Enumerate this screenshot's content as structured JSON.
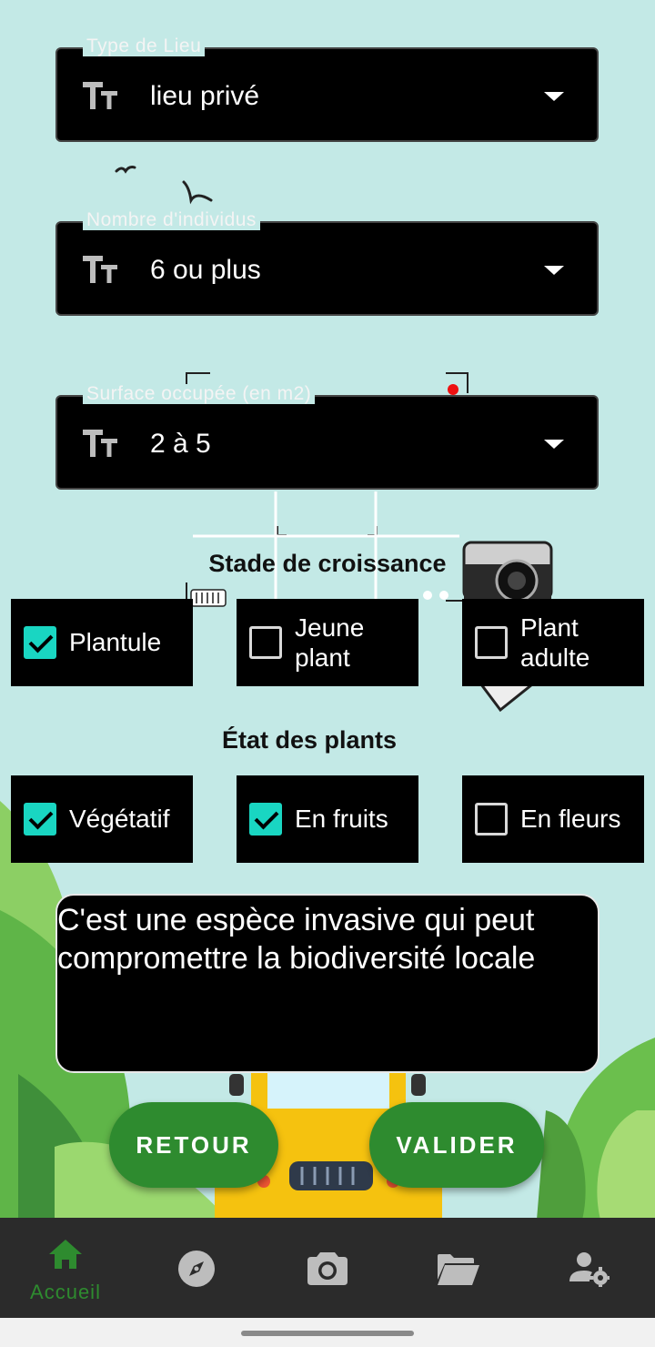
{
  "form": {
    "fields": [
      {
        "label": "Type de Lieu",
        "value": "lieu privé"
      },
      {
        "label": "Nombre d'individus",
        "value": "6 ou plus"
      },
      {
        "label": "Surface occupée (en m2)",
        "value": "2 à 5"
      }
    ],
    "growth_stage": {
      "title": "Stade de croissance",
      "options": [
        {
          "label": "Plantule",
          "checked": true
        },
        {
          "label": "Jeune plant",
          "checked": false
        },
        {
          "label": "Plant adulte",
          "checked": false
        }
      ]
    },
    "plant_state": {
      "title": "État des plants",
      "options": [
        {
          "label": "Végétatif",
          "checked": true
        },
        {
          "label": "En fruits",
          "checked": true
        },
        {
          "label": "En fleurs",
          "checked": false
        }
      ]
    },
    "comment": "C'est une espèce invasive qui peut compromettre la biodiversité locale"
  },
  "buttons": {
    "back": "RETOUR",
    "submit": "VALIDER"
  },
  "nav": {
    "items": [
      {
        "label": "Accueil",
        "icon": "home-icon",
        "active": true
      },
      {
        "icon": "compass-icon"
      },
      {
        "icon": "camera-icon"
      },
      {
        "icon": "folder-icon"
      },
      {
        "icon": "user-settings-icon"
      }
    ]
  },
  "colors": {
    "background": "#c3e9e6",
    "accent_green": "#2e8b2f",
    "checkbox_teal": "#19d6c2",
    "navbar": "#2b2b2b"
  }
}
